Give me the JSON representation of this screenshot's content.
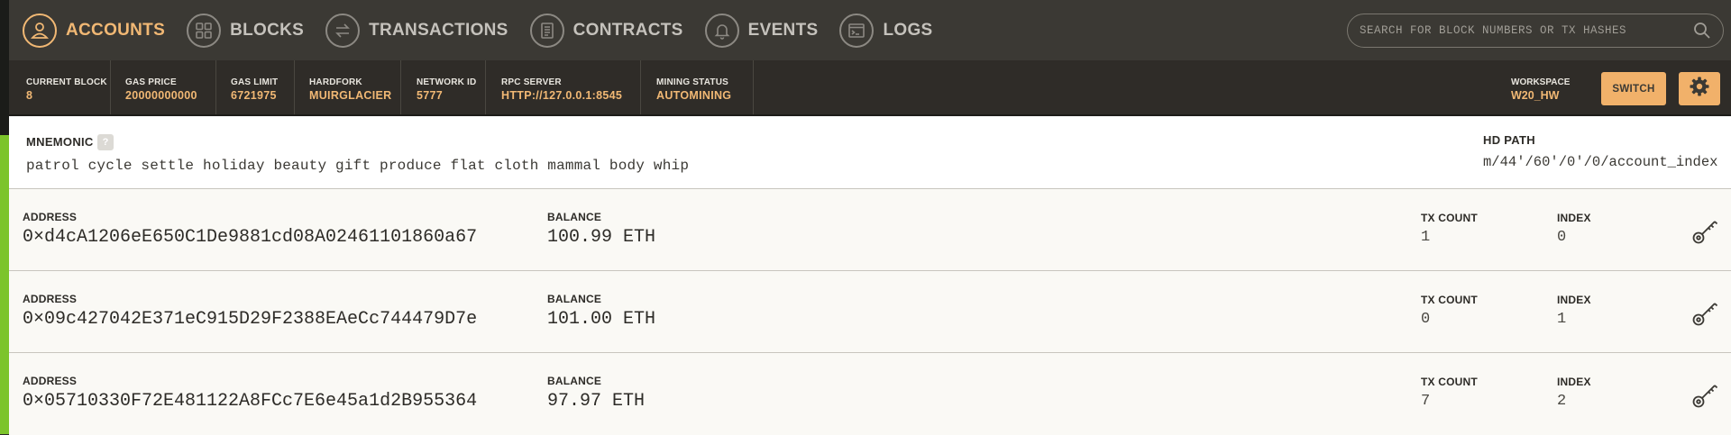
{
  "nav": {
    "items": [
      {
        "label": "ACCOUNTS",
        "icon": "user-icon",
        "active": true
      },
      {
        "label": "BLOCKS",
        "icon": "blocks-grid-icon",
        "active": false
      },
      {
        "label": "TRANSACTIONS",
        "icon": "swap-arrows-icon",
        "active": false
      },
      {
        "label": "CONTRACTS",
        "icon": "document-icon",
        "active": false
      },
      {
        "label": "EVENTS",
        "icon": "bell-icon",
        "active": false
      },
      {
        "label": "LOGS",
        "icon": "terminal-icon",
        "active": false
      }
    ],
    "search_placeholder": "SEARCH FOR BLOCK NUMBERS OR TX HASHES"
  },
  "status": {
    "current_block": {
      "label": "CURRENT BLOCK",
      "value": "8"
    },
    "gas_price": {
      "label": "GAS PRICE",
      "value": "20000000000"
    },
    "gas_limit": {
      "label": "GAS LIMIT",
      "value": "6721975"
    },
    "hardfork": {
      "label": "HARDFORK",
      "value": "MUIRGLACIER"
    },
    "network_id": {
      "label": "NETWORK ID",
      "value": "5777"
    },
    "rpc_server": {
      "label": "RPC SERVER",
      "value": "HTTP://127.0.0.1:8545"
    },
    "mining_status": {
      "label": "MINING STATUS",
      "value": "AUTOMINING"
    },
    "workspace": {
      "label": "WORKSPACE",
      "value": "W20_HW"
    },
    "switch_label": "SWITCH"
  },
  "mnemonic": {
    "label": "MNEMONIC",
    "help": "?",
    "words": "patrol cycle settle holiday beauty gift produce flat cloth mammal body whip",
    "hd_path_label": "HD PATH",
    "hd_path": "m/44'/60'/0'/0/account_index"
  },
  "labels": {
    "address": "ADDRESS",
    "balance": "BALANCE",
    "tx_count": "TX COUNT",
    "index": "INDEX"
  },
  "accounts": [
    {
      "address": "0×d4cA1206eE650C1De9881cd08A02461101860a67",
      "balance": "100.99 ETH",
      "tx_count": "1",
      "index": "0"
    },
    {
      "address": "0×09c427042E371eC915D29F2388EAeCc744479D7e",
      "balance": "101.00 ETH",
      "tx_count": "0",
      "index": "1"
    },
    {
      "address": "0×05710330F72E481122A8FCc7E6e45a1d2B955364",
      "balance": "97.97 ETH",
      "tx_count": "7",
      "index": "2"
    }
  ],
  "colors": {
    "accent": "#f1b874",
    "nav_bg": "#3b3934",
    "status_bg": "#2f2c28",
    "side_green": "#7cc42b"
  }
}
